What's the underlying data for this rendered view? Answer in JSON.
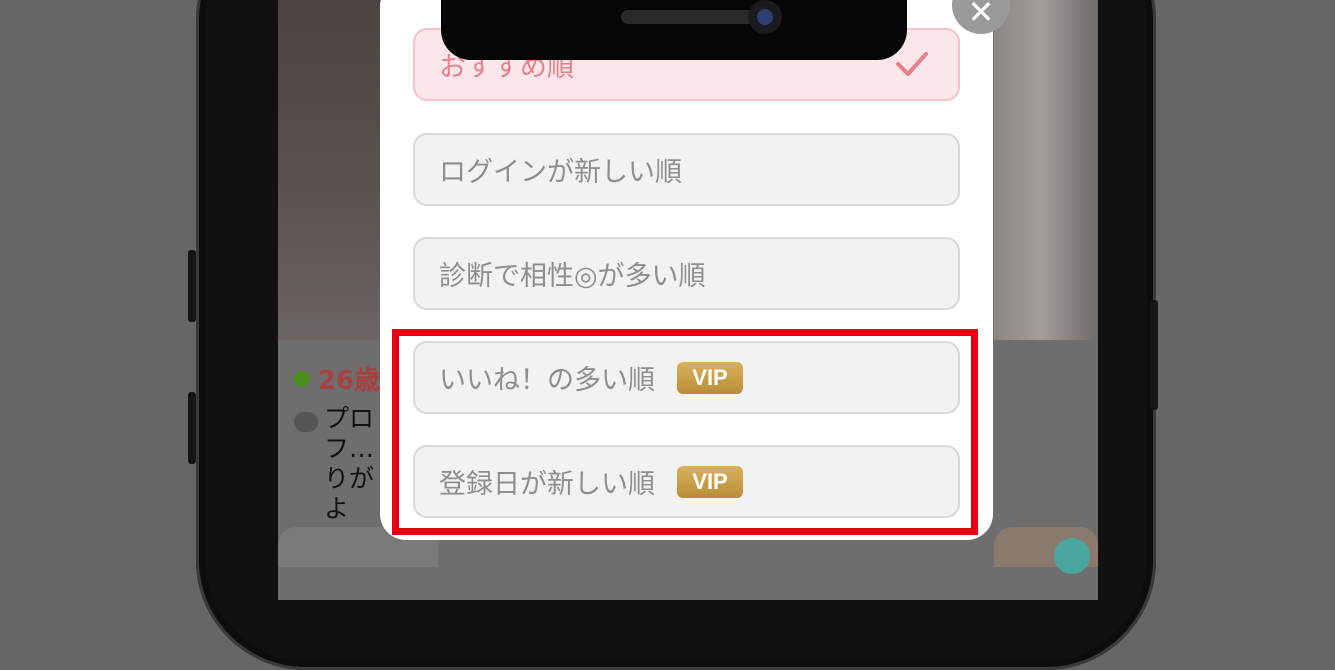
{
  "background": {
    "age": "26歳",
    "profile_text": "プロフ…りがよ"
  },
  "sort_sheet": {
    "options": [
      {
        "label": "おすすめ順",
        "selected": true
      },
      {
        "label": "ログインが新しい順"
      },
      {
        "label": "診断で相性◎が多い順"
      },
      {
        "label": "いいね！の多い順",
        "badge": "VIP"
      },
      {
        "label": "登録日が新しい順",
        "badge": "VIP"
      }
    ]
  },
  "close_label": "✕",
  "colors": {
    "selected_bg": "#fbe7e9",
    "selected_text": "#e8808c",
    "highlight": "#e60012",
    "vip_gold": "#c89a45"
  }
}
